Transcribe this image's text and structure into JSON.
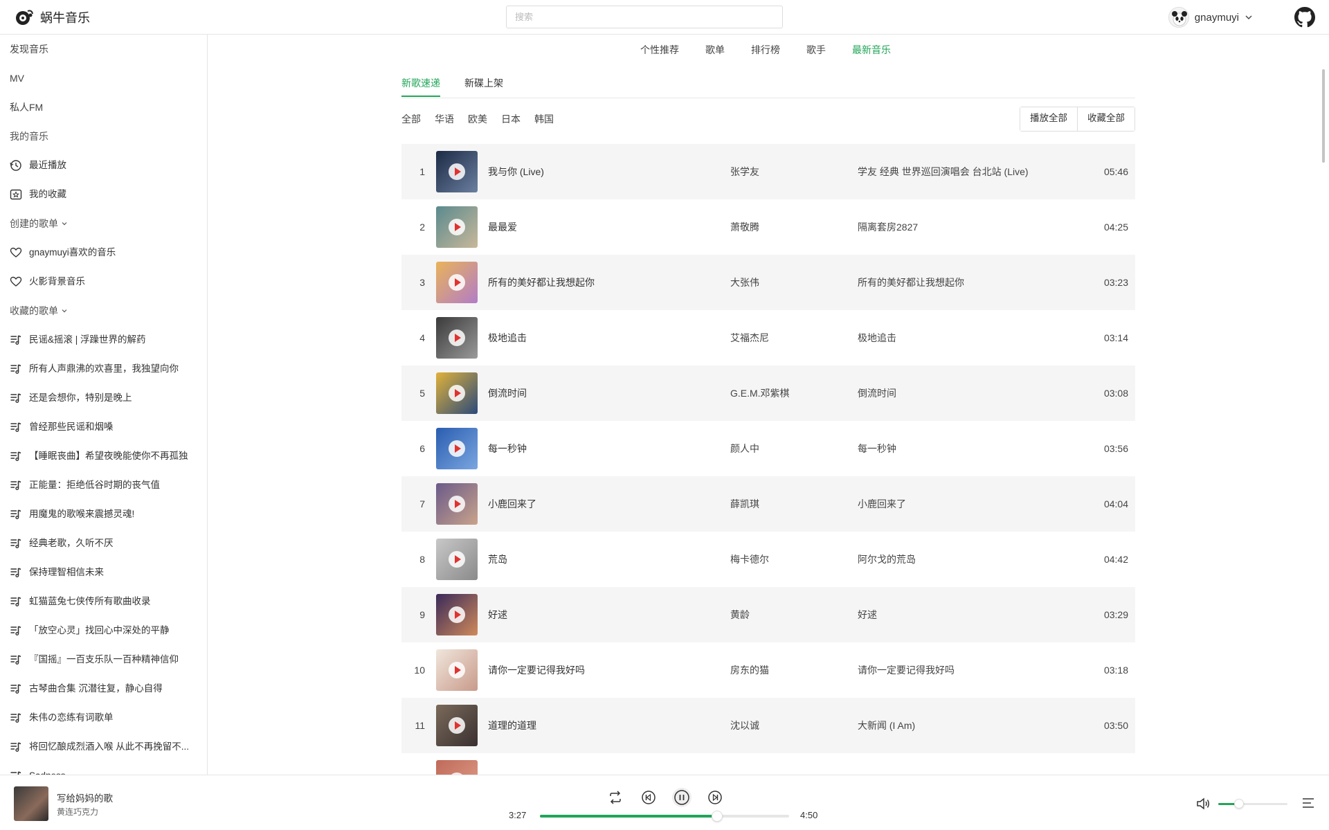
{
  "app": {
    "name": "蜗牛音乐"
  },
  "search": {
    "placeholder": "搜索"
  },
  "user": {
    "name": "gnaymuyi"
  },
  "sidebar": {
    "top": [
      {
        "label": "发现音乐"
      },
      {
        "label": "MV"
      },
      {
        "label": "私人FM"
      }
    ],
    "my_music_title": "我的音乐",
    "my_music": [
      {
        "label": "最近播放",
        "icon": "history-icon"
      },
      {
        "label": "我的收藏",
        "icon": "star-box-icon"
      }
    ],
    "created_title": "创建的歌单",
    "created": [
      {
        "label": "gnaymuyi喜欢的音乐",
        "icon": "heart-icon"
      },
      {
        "label": "火影背景音乐",
        "icon": "heart-icon"
      }
    ],
    "collected_title": "收藏的歌单",
    "collected": [
      {
        "label": "民谣&摇滚 | 浮躁世界的解药"
      },
      {
        "label": "所有人声鼎沸的欢喜里，我独望向你"
      },
      {
        "label": "还是会想你，特别是晚上"
      },
      {
        "label": "曾经那些民谣和烟嗓"
      },
      {
        "label": "【睡眠丧曲】希望夜晚能使你不再孤独"
      },
      {
        "label": "正能量：拒绝低谷时期的丧气值"
      },
      {
        "label": "用魔鬼的歌喉来震撼灵魂!"
      },
      {
        "label": "经典老歌，久听不厌"
      },
      {
        "label": "保持理智相信未来"
      },
      {
        "label": "虹猫蓝兔七侠传所有歌曲收录"
      },
      {
        "label": "「放空心灵」找回心中深处的平静"
      },
      {
        "label": "『国摇』一百支乐队一百种精神信仰"
      },
      {
        "label": "古琴曲合集 沉潜往复，静心自得"
      },
      {
        "label": "朱伟の恋练有词歌单"
      },
      {
        "label": "将回忆酿成烈酒入喉 从此不再挽留不..."
      },
      {
        "label": "Sadness"
      }
    ]
  },
  "nav": {
    "tabs": [
      {
        "label": "个性推荐"
      },
      {
        "label": "歌单"
      },
      {
        "label": "排行榜"
      },
      {
        "label": "歌手"
      },
      {
        "label": "最新音乐",
        "active": true
      }
    ]
  },
  "sub_tabs": [
    {
      "label": "新歌速递",
      "active": true
    },
    {
      "label": "新碟上架"
    }
  ],
  "regions": [
    "全部",
    "华语",
    "欧美",
    "日本",
    "韩国"
  ],
  "actions": {
    "play_all": "播放全部",
    "collect_all": "收藏全部"
  },
  "songs": [
    {
      "index": "1",
      "name": "我与你 (Live)",
      "artist": "张学友",
      "album": "学友 经典 世界巡回演唱会 台北站 (Live)",
      "duration": "05:46",
      "cover": [
        "#1c2a44",
        "#6b7fa0"
      ]
    },
    {
      "index": "2",
      "name": "最最爱",
      "artist": "萧敬腾",
      "album": "隔离套房2827",
      "duration": "04:25",
      "cover": [
        "#5a8a8e",
        "#c9b89a"
      ]
    },
    {
      "index": "3",
      "name": "所有的美好都让我想起你",
      "artist": "大张伟",
      "album": "所有的美好都让我想起你",
      "duration": "03:23",
      "cover": [
        "#e9b35a",
        "#b27cc7"
      ]
    },
    {
      "index": "4",
      "name": "极地追击",
      "artist": "艾福杰尼",
      "album": "极地追击",
      "duration": "03:14",
      "cover": [
        "#3a3a3a",
        "#9a9a9a"
      ]
    },
    {
      "index": "5",
      "name": "倒流时间",
      "artist": "G.E.M.邓紫棋",
      "album": "倒流时间",
      "duration": "03:08",
      "cover": [
        "#e0b23a",
        "#2b4a7a"
      ]
    },
    {
      "index": "6",
      "name": "每一秒钟",
      "artist": "颜人中",
      "album": "每一秒钟",
      "duration": "03:56",
      "cover": [
        "#2a5db0",
        "#7aa6e0"
      ]
    },
    {
      "index": "7",
      "name": "小鹿回来了",
      "artist": "薛凯琪",
      "album": "小鹿回来了",
      "duration": "04:04",
      "cover": [
        "#6a5a8a",
        "#c9a38a"
      ]
    },
    {
      "index": "8",
      "name": "荒岛",
      "artist": "梅卡德尔",
      "album": "阿尔戈的荒岛",
      "duration": "04:42",
      "cover": [
        "#c8c8c8",
        "#8a8a8a"
      ]
    },
    {
      "index": "9",
      "name": "好逑",
      "artist": "黄龄",
      "album": "好逑",
      "duration": "03:29",
      "cover": [
        "#3a2a5a",
        "#d08a5a"
      ]
    },
    {
      "index": "10",
      "name": "请你一定要记得我好吗",
      "artist": "房东的猫",
      "album": "请你一定要记得我好吗",
      "duration": "03:18",
      "cover": [
        "#f0e6dc",
        "#c89a8a"
      ]
    },
    {
      "index": "11",
      "name": "道理的道理",
      "artist": "沈以诚",
      "album": "大新闻 (I Am)",
      "duration": "03:50",
      "cover": [
        "#7a6a5a",
        "#3a3030"
      ]
    },
    {
      "index": "",
      "name": "",
      "artist": "",
      "album": "",
      "duration": "",
      "cover": [
        "#c06a5a",
        "#e0a08a"
      ]
    }
  ],
  "player": {
    "title": "写给妈妈的歌",
    "artist": "黄连巧克力",
    "current_time": "3:27",
    "total_time": "4:50",
    "progress": 0.71,
    "volume": 0.3,
    "accent": "#21a558"
  }
}
